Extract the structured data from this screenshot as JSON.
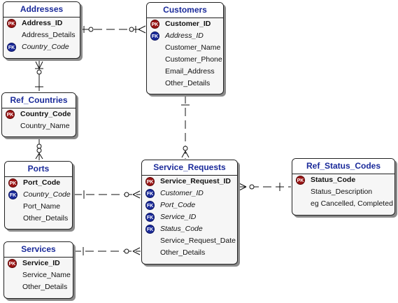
{
  "entities": {
    "addresses": {
      "name": "Addresses",
      "pk": [
        {
          "label": "Address_ID",
          "key": "PK"
        }
      ],
      "fields": [
        {
          "label": "Address_Details",
          "key": ""
        },
        {
          "label": "Country_Code",
          "key": "FK"
        }
      ]
    },
    "customers": {
      "name": "Customers",
      "pk": [
        {
          "label": "Customer_ID",
          "key": "PK"
        },
        {
          "label": "Address_ID",
          "key": "FK"
        }
      ],
      "fields": [
        {
          "label": "Customer_Name",
          "key": ""
        },
        {
          "label": "Customer_Phone",
          "key": ""
        },
        {
          "label": "Email_Address",
          "key": ""
        },
        {
          "label": "Other_Details",
          "key": ""
        }
      ]
    },
    "ref_countries": {
      "name": "Ref_Countries",
      "pk": [
        {
          "label": "Country_Code",
          "key": "PK"
        }
      ],
      "fields": [
        {
          "label": "Country_Name",
          "key": ""
        }
      ]
    },
    "ports": {
      "name": "Ports",
      "pk": [
        {
          "label": "Port_Code",
          "key": "PK"
        }
      ],
      "fields": [
        {
          "label": "Country_Code",
          "key": "FK"
        },
        {
          "label": "Port_Name",
          "key": ""
        },
        {
          "label": "Other_Details",
          "key": ""
        }
      ]
    },
    "service_requests": {
      "name": "Service_Requests",
      "pk": [
        {
          "label": "Service_Request_ID",
          "key": "PK"
        }
      ],
      "fields": [
        {
          "label": "Customer_ID",
          "key": "FK"
        },
        {
          "label": "Port_Code",
          "key": "FK"
        },
        {
          "label": "Service_ID",
          "key": "FK"
        },
        {
          "label": "Status_Code",
          "key": "FK"
        },
        {
          "label": "Service_Request_Date",
          "key": ""
        },
        {
          "label": "Other_Details",
          "key": ""
        }
      ]
    },
    "ref_status_codes": {
      "name": "Ref_Status_Codes",
      "pk": [
        {
          "label": "Status_Code",
          "key": "PK"
        }
      ],
      "fields": [
        {
          "label": "Status_Description",
          "key": ""
        },
        {
          "label": "eg Cancelled, Completed",
          "key": ""
        }
      ]
    },
    "services": {
      "name": "Services",
      "pk": [
        {
          "label": "Service_ID",
          "key": "PK"
        }
      ],
      "fields": [
        {
          "label": "Service_Name",
          "key": ""
        },
        {
          "label": "Other_Details",
          "key": ""
        }
      ]
    }
  },
  "relationships": [
    {
      "from": "addresses",
      "to": "customers"
    },
    {
      "from": "ref_countries",
      "to": "addresses"
    },
    {
      "from": "ref_countries",
      "to": "ports"
    },
    {
      "from": "customers",
      "to": "service_requests"
    },
    {
      "from": "ports",
      "to": "service_requests"
    },
    {
      "from": "services",
      "to": "service_requests"
    },
    {
      "from": "ref_status_codes",
      "to": "service_requests"
    }
  ],
  "colors": {
    "header_text": "#1a2a9a",
    "pk_badge": "#9b1414",
    "fk_badge": "#1a2a9a"
  }
}
